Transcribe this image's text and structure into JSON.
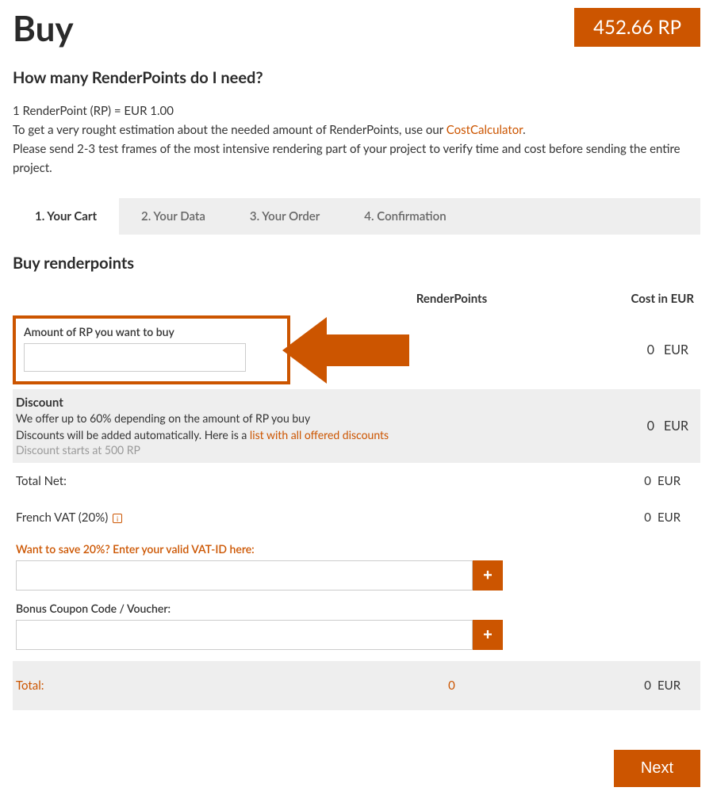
{
  "header": {
    "title": "Buy",
    "balance": "452.66 RP"
  },
  "intro": {
    "heading": "How many RenderPoints do I need?",
    "line1": "1 RenderPoint (RP) = EUR 1.00",
    "line2a": "To get a very rought estimation about the needed amount of RenderPoints, use our ",
    "cost_link": "CostCalculator",
    "line2b": ".",
    "line3": "Please send 2-3 test frames of the most intensive rendering part of your project to verify time and cost before sending the entire project."
  },
  "tabs": {
    "t1": "1. Your Cart",
    "t2": "2. Your Data",
    "t3": "3. Your Order",
    "t4": "4. Confirmation"
  },
  "section_heading": "Buy renderpoints",
  "table_head": {
    "mid": "RenderPoints",
    "right": "Cost in EUR"
  },
  "amount": {
    "label": "Amount of RP you want to buy",
    "value": "0",
    "unit": "EUR"
  },
  "discount": {
    "title": "Discount",
    "line1": "We offer up to 60% depending on the amount of RP you buy",
    "line2a": "Discounts will be added automatically. Here is a ",
    "link": "list with all offered discounts",
    "muted": "Discount starts at 500 RP",
    "value": "0",
    "unit": "EUR"
  },
  "totalnet": {
    "label": "Total Net:",
    "value": "0",
    "unit": "EUR"
  },
  "vat": {
    "label": "French VAT (20%)",
    "value": "0",
    "unit": "EUR"
  },
  "vatid_label": "Want to save 20%? Enter your valid VAT-ID here:",
  "coupon_label": "Bonus Coupon Code / Voucher:",
  "plus": "+",
  "total": {
    "label": "Total:",
    "mid": "0",
    "value": "0",
    "unit": "EUR"
  },
  "next": "Next"
}
